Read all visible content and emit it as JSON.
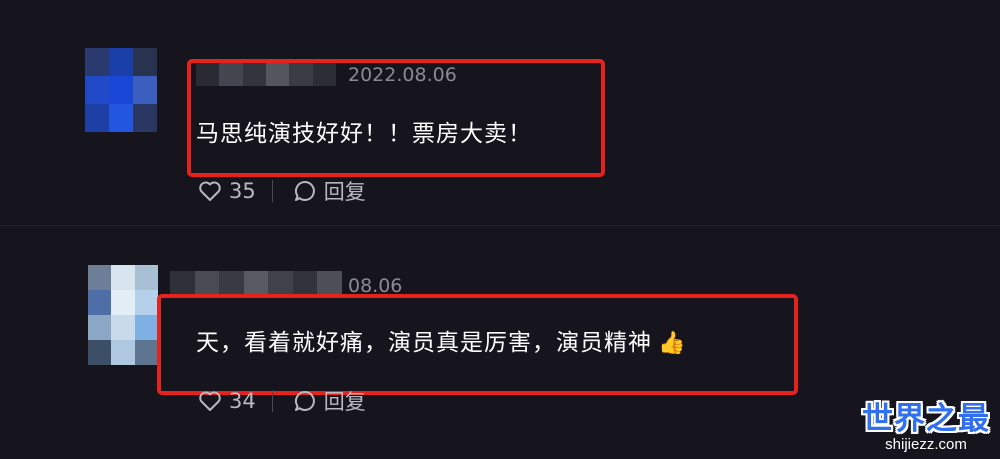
{
  "comments": [
    {
      "date": "2022.08.06",
      "text": "马思纯演技好好！！票房大卖！",
      "emoji": "",
      "likes": "35",
      "reply_label": "回复"
    },
    {
      "date": "08.06",
      "text": "天，看着就好痛，演员真是厉害，演员精神",
      "emoji": "👍",
      "likes": "34",
      "reply_label": "回复"
    }
  ],
  "watermark": {
    "title": "世界之最",
    "subtitle": "shijiezz.com"
  },
  "colors": {
    "background": "#16151d",
    "highlight": "#e5221d",
    "meta_text": "#8a8a92",
    "watermark_blue": "#2f6ff0"
  },
  "icons": {
    "like": "heart-icon",
    "reply": "speech-bubble-icon",
    "emoji": "thumbs-up-emoji"
  }
}
